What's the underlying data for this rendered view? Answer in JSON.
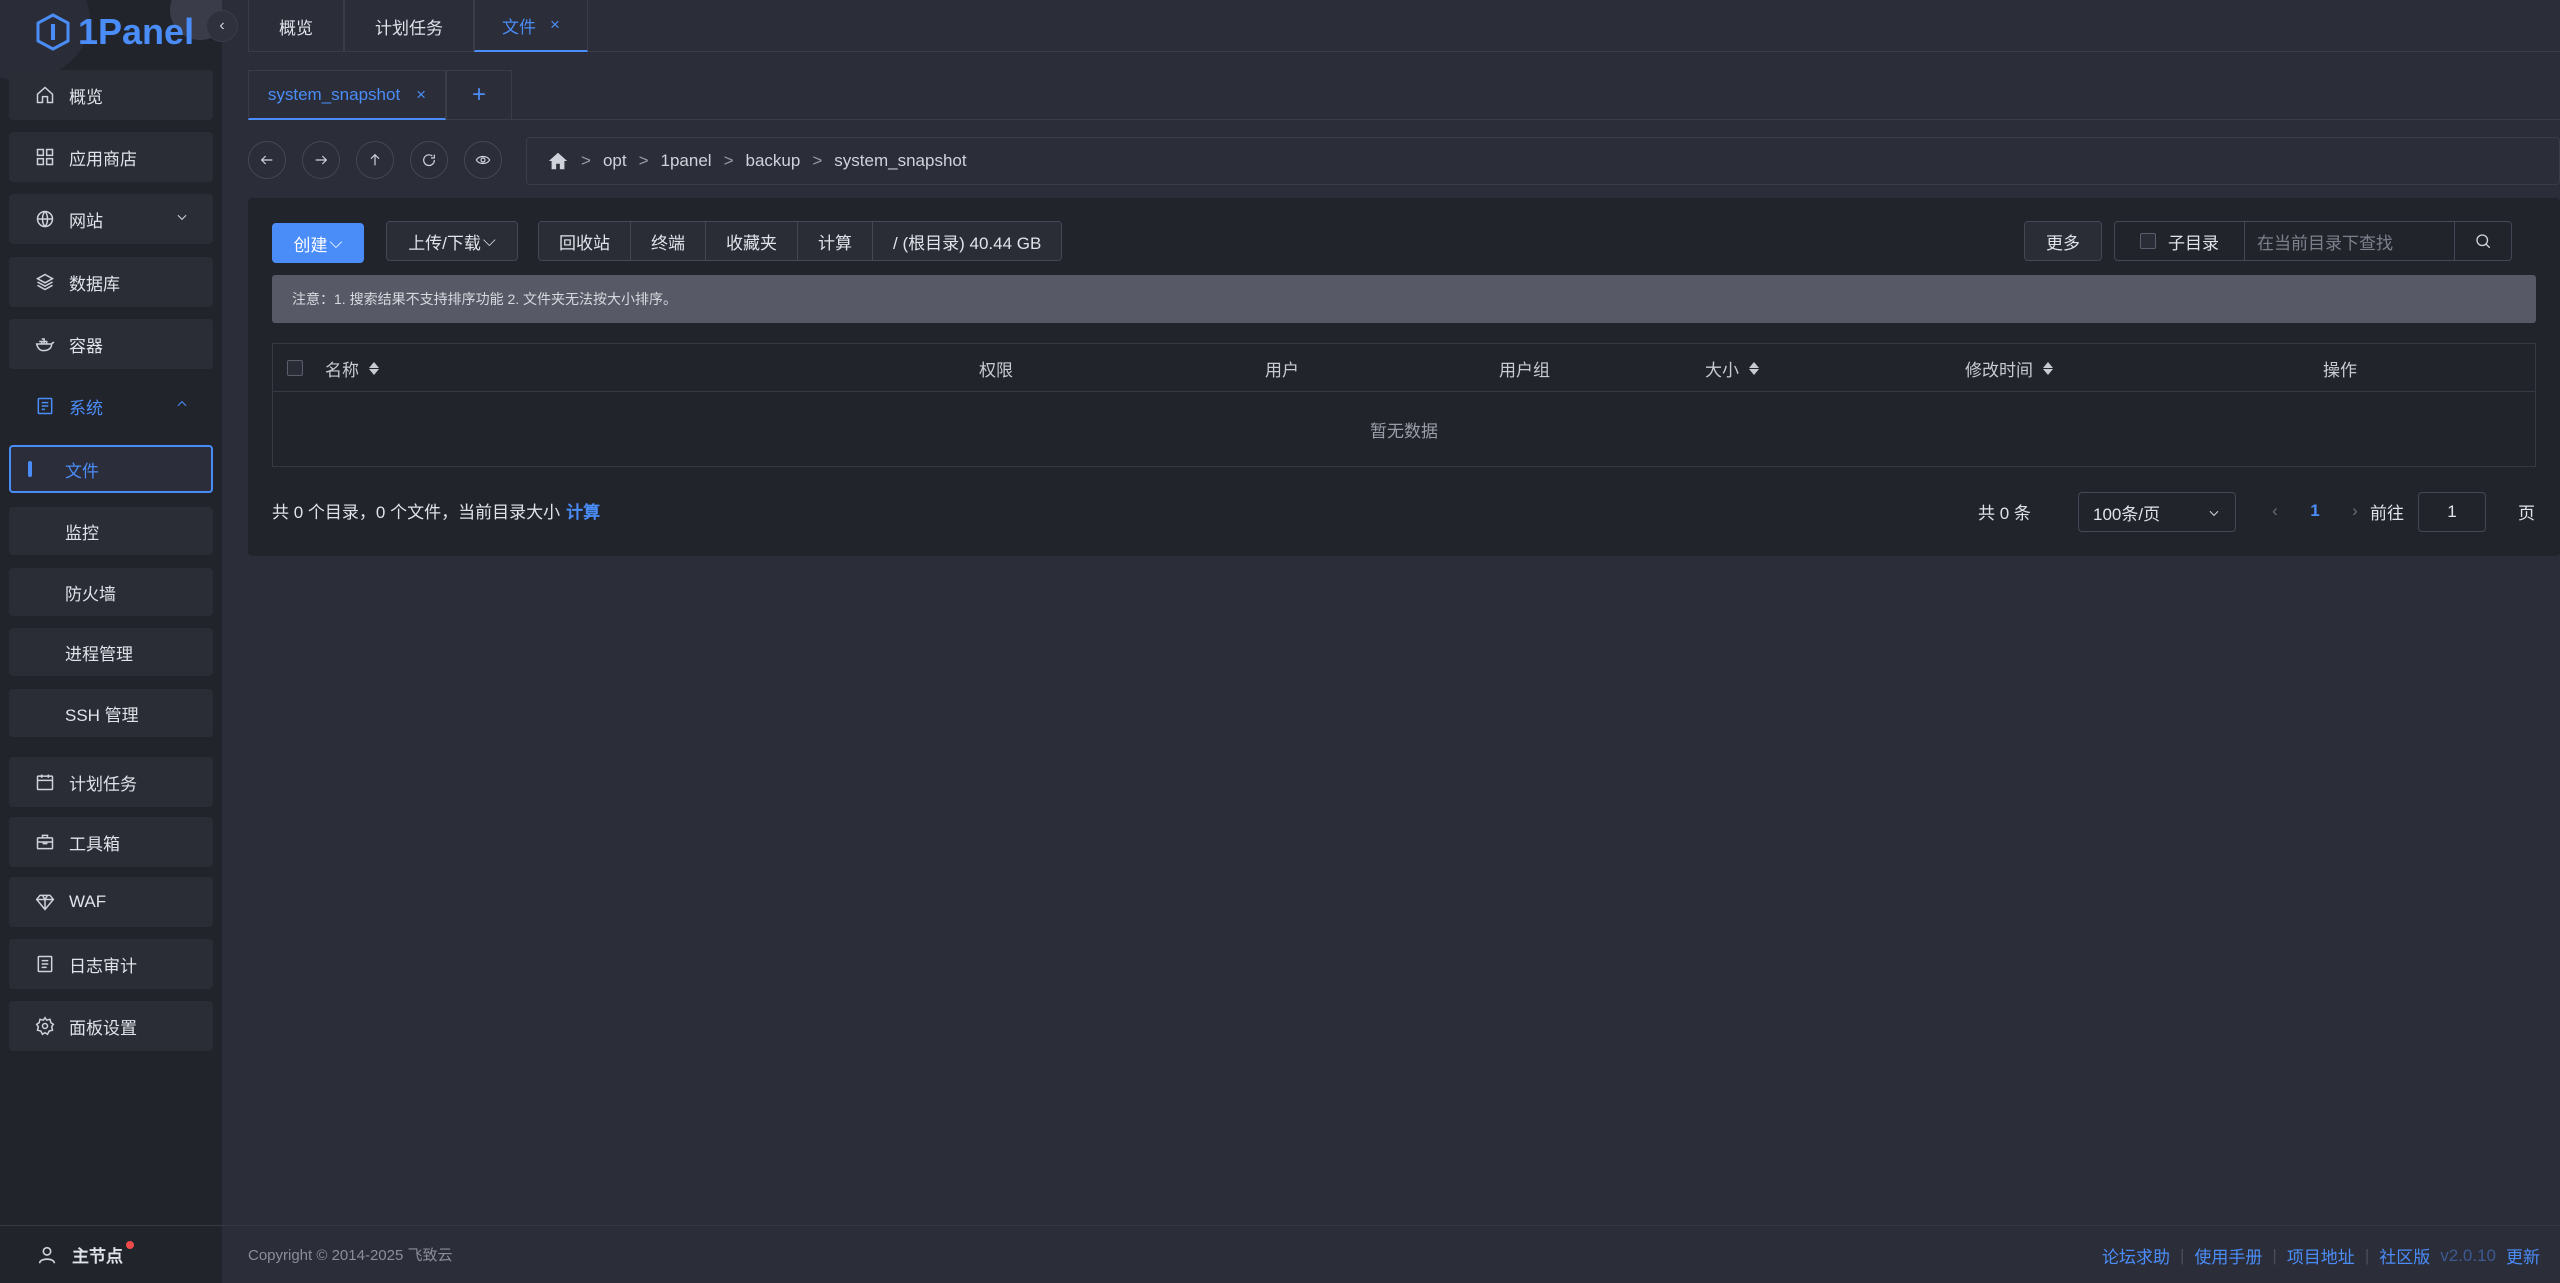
{
  "brand": {
    "name": "1Panel",
    "accent": "#4b8df8"
  },
  "sidebar": {
    "items": [
      {
        "label": "概览",
        "icon": "home-icon"
      },
      {
        "label": "应用商店",
        "icon": "grid-icon"
      },
      {
        "label": "网站",
        "icon": "globe-icon"
      },
      {
        "label": "数据库",
        "icon": "layers-icon"
      },
      {
        "label": "容器",
        "icon": "docker-icon"
      },
      {
        "label": "系统",
        "icon": "server-icon"
      },
      {
        "label": "计划任务",
        "icon": "calendar-icon"
      },
      {
        "label": "工具箱",
        "icon": "toolbox-icon"
      },
      {
        "label": "WAF",
        "icon": "diamond-icon"
      },
      {
        "label": "日志审计",
        "icon": "log-icon"
      },
      {
        "label": "面板设置",
        "icon": "gear-icon"
      }
    ],
    "system_sub": [
      "文件",
      "监控",
      "防火墙",
      "进程管理",
      "SSH 管理"
    ],
    "footer_label": "主节点"
  },
  "top_tabs": [
    {
      "label": "概览"
    },
    {
      "label": "计划任务"
    },
    {
      "label": "文件",
      "close": "×"
    }
  ],
  "file_tab": {
    "label": "system_snapshot",
    "close": "×",
    "add": "+"
  },
  "path": {
    "segments": [
      "opt",
      "1panel",
      "backup",
      "system_snapshot"
    ],
    "separator": ">"
  },
  "toolbar": {
    "create": "创建",
    "upload": "上传/下载",
    "group": [
      "回收站",
      "终端",
      "收藏夹",
      "计算"
    ],
    "disk": "/ (根目录) 40.44 GB",
    "more": "更多",
    "subdir": "子目录",
    "search_placeholder": "在当前目录下查找"
  },
  "notice": "注意：1. 搜索结果不支持排序功能 2. 文件夹无法按大小排序。",
  "table": {
    "headers": [
      "名称",
      "权限",
      "用户",
      "用户组",
      "大小",
      "修改时间",
      "操作"
    ],
    "empty": "暂无数据"
  },
  "summary": {
    "text": "共 0 个目录，0 个文件，当前目录大小",
    "link": "计算"
  },
  "pagination": {
    "total": "共 0 条",
    "page_size": "100条/页",
    "current": "1",
    "goto_label": "前往",
    "goto_value": "1",
    "page_suffix": "页"
  },
  "footer": {
    "copyright": "Copyright © 2014-2025 飞致云",
    "links": [
      "论坛求助",
      "使用手册",
      "项目地址",
      "社区版"
    ],
    "version": "v2.0.10",
    "update": "更新"
  }
}
